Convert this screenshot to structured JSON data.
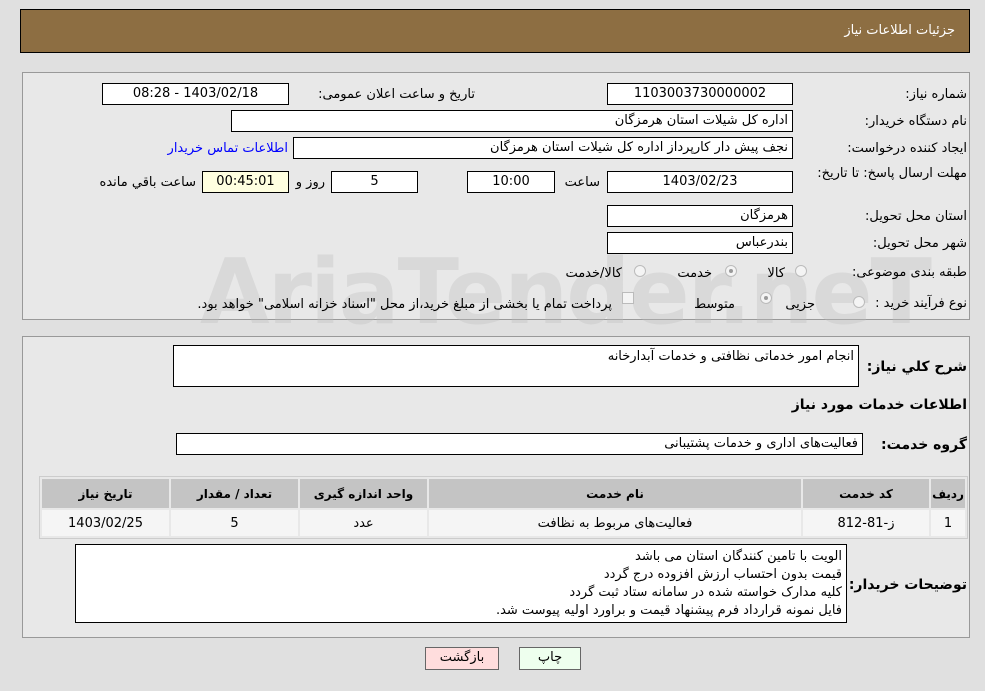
{
  "header": {
    "title": "جزئیات اطلاعات نیاز"
  },
  "form": {
    "need_number_label": "شماره نیاز:",
    "need_number": "1103003730000002",
    "announce_label": "تاریخ و ساعت اعلان عمومی:",
    "announce_value": "1403/02/18 - 08:28",
    "buyer_label": "نام دستگاه خریدار:",
    "buyer_value": "اداره کل شیلات استان هرمزگان",
    "creator_label": "ایجاد کننده درخواست:",
    "creator_value": "نجف پیش دار کارپرداز اداره کل شیلات استان هرمزگان",
    "contact_link": "اطلاعات تماس خریدار",
    "deadline_label": "مهلت ارسال پاسخ: تا تاریخ:",
    "deadline_date": "1403/02/23",
    "time_label": "ساعت",
    "deadline_time": "10:00",
    "days": "5",
    "days_label": "روز و",
    "remaining": "00:45:01",
    "remaining_label": "ساعت باقي مانده",
    "province_label": "استان محل تحویل:",
    "province_value": "هرمزگان",
    "city_label": "شهر محل تحویل:",
    "city_value": "بندرعباس",
    "category_label": "طبقه بندی موضوعی:",
    "category_options": [
      "کالا",
      "خدمت",
      "کالا/خدمت"
    ],
    "category_selected": "خدمت",
    "process_label": "نوع فرآیند خرید :",
    "process_options": [
      "جزیی",
      "متوسط"
    ],
    "process_selected": "متوسط",
    "payment_note": "پرداخت تمام یا بخشی از مبلغ خرید،از محل \"اسناد خزانه اسلامی\" خواهد بود."
  },
  "details": {
    "summary_label": "شرح کلي نياز:",
    "summary_value": "انجام امور خدماتی نظافتی و خدمات آبدارخانه",
    "services_heading": "اطلاعات خدمات مورد نياز",
    "group_label": "گروه خدمت:",
    "group_value": "فعالیت‌های اداری و خدمات پشتیبانی",
    "table": {
      "headers": [
        "ردیف",
        "کد خدمت",
        "نام خدمت",
        "واحد اندازه گیری",
        "تعداد / مقدار",
        "تاریخ نیاز"
      ],
      "rows": [
        [
          "1",
          "ز-81-812",
          "فعالیت‌های مربوط به نظافت",
          "عدد",
          "5",
          "1403/02/25"
        ]
      ]
    },
    "notes_label": "توضیحات خریدار:",
    "notes": [
      "الویت با تامین کنندگان استان می باشد",
      "قیمت بدون احتساب ارزش افزوده درج گردد",
      "کلیه مدارک خواسته شده در سامانه ستاد ثبت گردد",
      "فایل نمونه قرارداد  فرم پیشنهاد قیمت و براورد اولیه پیوست شد."
    ]
  },
  "buttons": {
    "print": "چاپ",
    "back": "بازگشت"
  },
  "watermark": "AriaTender.neT",
  "colors": {
    "header": "#8d6e42",
    "link": "#0000ff",
    "remaining_bg": "#ffffe0",
    "back_bg": "#ffdddd",
    "print_bg": "#eeffee"
  }
}
